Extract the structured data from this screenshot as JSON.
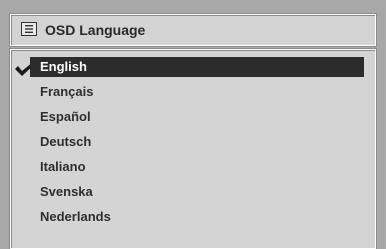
{
  "header": {
    "icon": "menu-list-icon",
    "title": "OSD Language"
  },
  "languages": {
    "items": [
      {
        "label": "English",
        "selected": true
      },
      {
        "label": "Français",
        "selected": false
      },
      {
        "label": "Español",
        "selected": false
      },
      {
        "label": "Deutsch",
        "selected": false
      },
      {
        "label": "Italiano",
        "selected": false
      },
      {
        "label": "Svenska",
        "selected": false
      },
      {
        "label": "Nederlands",
        "selected": false
      }
    ]
  },
  "colors": {
    "panel_background": "#a8a8a8",
    "box_background": "#d4d4d4",
    "selection_background": "#2c2c2c",
    "selection_text": "#ffffff"
  }
}
